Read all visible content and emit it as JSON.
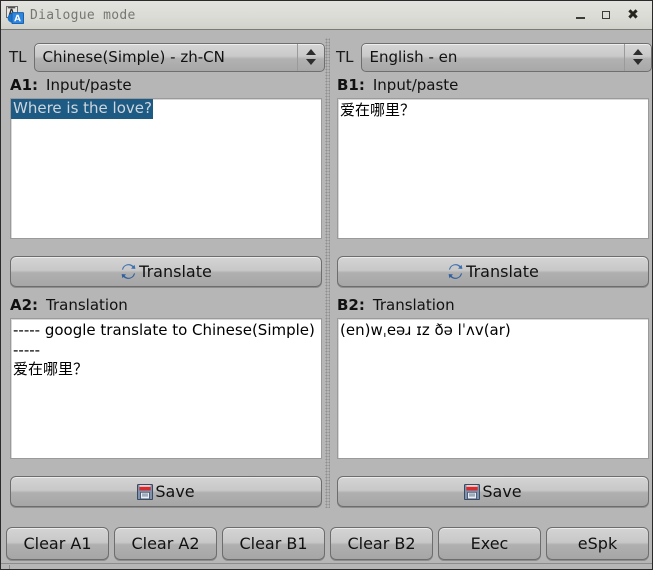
{
  "window": {
    "title": "Dialogue mode",
    "app_icon": "translate-icon",
    "controls": {
      "minimize": "minimize-icon",
      "maximize": "maximize-icon",
      "close": "✖"
    }
  },
  "panes": {
    "left": {
      "tl_label": "TL",
      "language": "Chinese(Simple) - zh-CN",
      "input": {
        "tag": "A1:",
        "caption": "Input/paste",
        "value": "Where is the love?",
        "selected": true
      },
      "translate_button": {
        "label": "Translate",
        "icon": "refresh-sync-icon"
      },
      "output": {
        "tag": "A2:",
        "caption": "Translation",
        "value": "----- google translate to Chinese(Simple) -----\n爱在哪里？"
      },
      "save_button": {
        "label": "Save",
        "icon": "floppy-disk-icon"
      }
    },
    "right": {
      "tl_label": "TL",
      "language": "English - en",
      "input": {
        "tag": "B1:",
        "caption": "Input/paste",
        "value": "爱在哪里？",
        "selected": false
      },
      "translate_button": {
        "label": "Translate",
        "icon": "refresh-sync-icon"
      },
      "output": {
        "tag": "B2:",
        "caption": "Translation",
        "value": "(en)wˌeəɹ ɪz ðə lˈʌv(ar)"
      },
      "save_button": {
        "label": "Save",
        "icon": "floppy-disk-icon"
      }
    }
  },
  "bottom_bar": {
    "buttons": [
      {
        "label": "Clear A1"
      },
      {
        "label": "Clear A2"
      },
      {
        "label": "Clear B1"
      },
      {
        "label": "Clear B2"
      },
      {
        "label": "Exec"
      },
      {
        "label": "eSpk"
      }
    ]
  },
  "colors": {
    "window_background": "#b6b6b6",
    "titlebar": "#dcdcd7",
    "selection_highlight": "#1d5b85",
    "selection_text": "#cfd6db",
    "text": "#111111",
    "field_background": "#ffffff",
    "icon_blue": "#3c6fb0",
    "icon_red": "#d92b2b"
  }
}
